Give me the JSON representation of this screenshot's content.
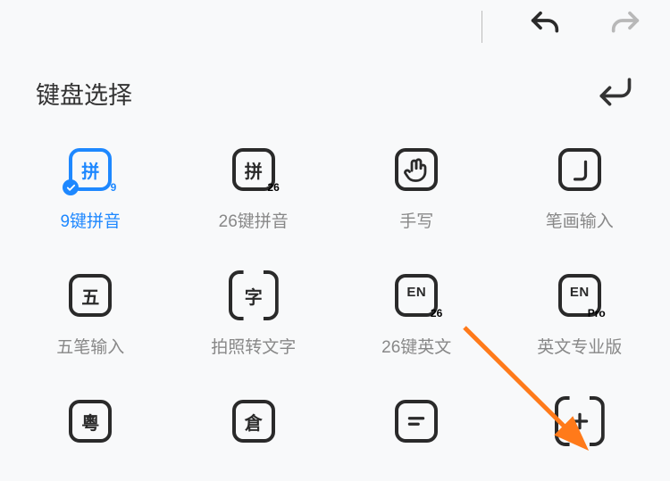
{
  "header": {
    "title": "键盘选择"
  },
  "tiles": [
    {
      "glyph": "拼",
      "sub": "9",
      "label": "9键拼音",
      "sel": true,
      "check": true,
      "style": "sq"
    },
    {
      "glyph": "拼",
      "sub": "26",
      "label": "26键拼音",
      "sel": false,
      "style": "sq"
    },
    {
      "svg": "hand",
      "label": "手写",
      "sel": false,
      "style": "sq"
    },
    {
      "svg": "stroke",
      "label": "笔画输入",
      "sel": false,
      "style": "sq"
    },
    {
      "glyph": "五",
      "label": "五笔输入",
      "sel": false,
      "style": "sq"
    },
    {
      "glyph": "字",
      "label": "拍照转文字",
      "sel": false,
      "style": "brk"
    },
    {
      "glyph": "EN",
      "sub": "26",
      "label": "26键英文",
      "sel": false,
      "style": "sq"
    },
    {
      "glyph": "EN",
      "sub": "Pro",
      "label": "英文专业版",
      "sel": false,
      "style": "sq"
    },
    {
      "glyph": "粵",
      "label": "",
      "sel": false,
      "style": "sq"
    },
    {
      "glyph": "倉",
      "label": "",
      "sel": false,
      "style": "sq"
    },
    {
      "svg": "lines",
      "label": "",
      "sel": false,
      "style": "sq"
    },
    {
      "svg": "plus",
      "label": "",
      "sel": false,
      "style": "brk"
    }
  ]
}
